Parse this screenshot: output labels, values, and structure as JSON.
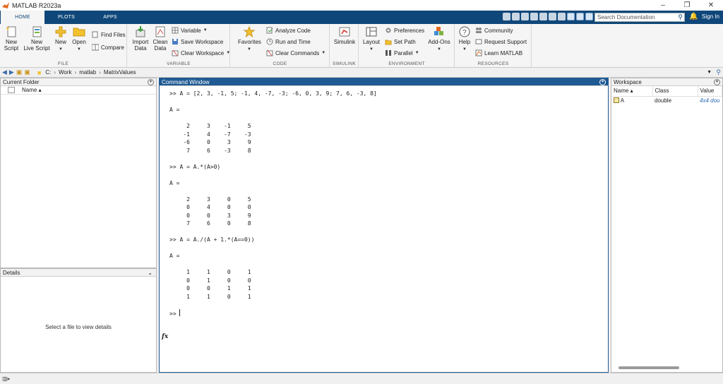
{
  "window": {
    "title": "MATLAB R2023a",
    "controls": [
      "–",
      "❐",
      "✕"
    ]
  },
  "tabs": [
    {
      "label": "HOME",
      "active": true
    },
    {
      "label": "PLOTS",
      "active": false
    },
    {
      "label": "APPS",
      "active": false
    }
  ],
  "search": {
    "placeholder": "Search Documentation"
  },
  "account": {
    "signin": "Sign In"
  },
  "ribbon": {
    "file": {
      "label": "FILE",
      "new_script": [
        "New",
        "Script"
      ],
      "new_live": [
        "New",
        "Live Script"
      ],
      "new": "New",
      "open": "Open",
      "find_files": "Find Files",
      "compare": "Compare"
    },
    "variable": {
      "label": "VARIABLE",
      "import": [
        "Import",
        "Data"
      ],
      "clean": [
        "Clean",
        "Data"
      ],
      "variable": "Variable",
      "save_ws": "Save Workspace",
      "clear_ws": "Clear Workspace"
    },
    "code": {
      "label": "CODE",
      "favorites": "Favorites",
      "analyze": "Analyze Code",
      "run_time": "Run and Time",
      "clear_cmds": "Clear Commands"
    },
    "simulink": {
      "label": "SIMULINK",
      "simulink": "Simulink"
    },
    "environment": {
      "label": "ENVIRONMENT",
      "layout": "Layout",
      "prefs": "Preferences",
      "set_path": "Set Path",
      "parallel": "Parallel",
      "addons": "Add-Ons"
    },
    "resources": {
      "label": "RESOURCES",
      "help": "Help",
      "community": "Community",
      "request": "Request Support",
      "learn": "Learn MATLAB"
    }
  },
  "address": {
    "segments": [
      "C:",
      "Work",
      "matlab",
      "MatrixValues"
    ]
  },
  "current_folder": {
    "title": "Current Folder",
    "col_name": "Name ▴"
  },
  "details": {
    "title": "Details",
    "message": "Select a file to view details"
  },
  "command_window": {
    "title": "Command Window",
    "lines": [
      ">> A = [2, 3, -1, 5; -1, 4, -7, -3; -6, 0, 3, 9; 7, 6, -3, 8]",
      "",
      "A =",
      "",
      "     2     3    -1     5",
      "    -1     4    -7    -3",
      "    -6     0     3     9",
      "     7     6    -3     8",
      "",
      ">> A = A.*(A>0)",
      "",
      "A =",
      "",
      "     2     3     0     5",
      "     0     4     0     0",
      "     0     0     3     9",
      "     7     6     0     8",
      "",
      ">> A = A./(A + 1.*(A==0))",
      "",
      "A =",
      "",
      "     1     1     0     1",
      "     0     1     0     0",
      "     0     0     1     1",
      "     1     1     0     1",
      "",
      ">> "
    ],
    "fx": "fx"
  },
  "workspace": {
    "title": "Workspace",
    "columns": [
      "Name ▴",
      "Class",
      "Value"
    ],
    "rows": [
      {
        "name": "A",
        "class": "double",
        "value": "4x4 dou"
      }
    ]
  },
  "colors": {
    "accent": "#10477a",
    "cw_header": "#1f5a92"
  }
}
